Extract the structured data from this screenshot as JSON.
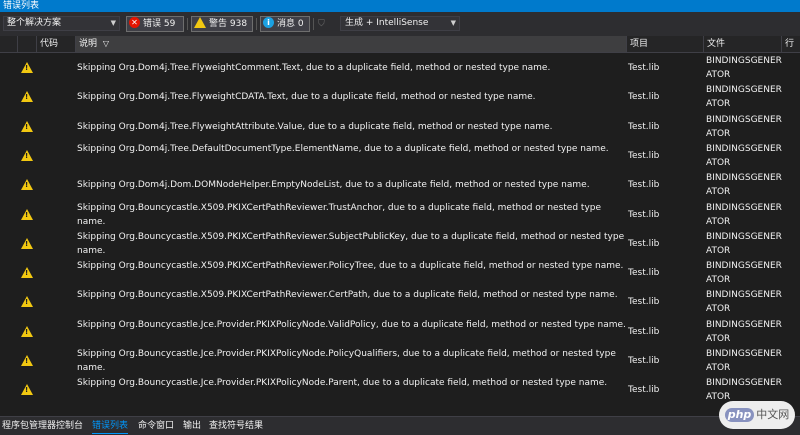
{
  "window": {
    "title": "错误列表"
  },
  "toolbar": {
    "scope": "整个解决方案",
    "errors_label": "错误 59",
    "warnings_label": "警告 938",
    "messages_label": "消息 0",
    "build_filter": "生成 + IntelliSense"
  },
  "columns": {
    "code": "代码",
    "description": "说明",
    "project": "项目",
    "file": "文件",
    "line": "行"
  },
  "rows": [
    {
      "desc": "Skipping Org.Dom4j.Tree.FlyweightComment.Text, due to a duplicate field, method or nested type name.",
      "project": "Test.lib",
      "file": "BINDINGSGENERATOR"
    },
    {
      "desc": "Skipping Org.Dom4j.Tree.FlyweightCDATA.Text, due to a duplicate field, method or nested type name.",
      "project": "Test.lib",
      "file": "BINDINGSGENERATOR"
    },
    {
      "desc": "Skipping Org.Dom4j.Tree.FlyweightAttribute.Value, due to a duplicate field, method or nested type name.",
      "project": "Test.lib",
      "file": "BINDINGSGENERATOR"
    },
    {
      "desc": "Skipping Org.Dom4j.Tree.DefaultDocumentType.ElementName, due to a duplicate field, method or nested type name.",
      "project": "Test.lib",
      "file": "BINDINGSGENERATOR"
    },
    {
      "desc": "Skipping Org.Dom4j.Dom.DOMNodeHelper.EmptyNodeList, due to a duplicate field, method or nested type name.",
      "project": "Test.lib",
      "file": "BINDINGSGENERATOR"
    },
    {
      "desc": "Skipping Org.Bouncycastle.X509.PKIXCertPathReviewer.TrustAnchor, due to a duplicate field, method or nested type name.",
      "project": "Test.lib",
      "file": "BINDINGSGENERATOR"
    },
    {
      "desc": "Skipping Org.Bouncycastle.X509.PKIXCertPathReviewer.SubjectPublicKey, due to a duplicate field, method or nested type name.",
      "project": "Test.lib",
      "file": "BINDINGSGENERATOR"
    },
    {
      "desc": "Skipping Org.Bouncycastle.X509.PKIXCertPathReviewer.PolicyTree, due to a duplicate field, method or nested type name.",
      "project": "Test.lib",
      "file": "BINDINGSGENERATOR"
    },
    {
      "desc": "Skipping Org.Bouncycastle.X509.PKIXCertPathReviewer.CertPath, due to a duplicate field, method or nested type name.",
      "project": "Test.lib",
      "file": "BINDINGSGENERATOR"
    },
    {
      "desc": "Skipping Org.Bouncycastle.Jce.Provider.PKIXPolicyNode.ValidPolicy, due to a duplicate field, method or nested type name.",
      "project": "Test.lib",
      "file": "BINDINGSGENERATOR"
    },
    {
      "desc": "Skipping Org.Bouncycastle.Jce.Provider.PKIXPolicyNode.PolicyQualifiers, due to a duplicate field, method or nested type name.",
      "project": "Test.lib",
      "file": "BINDINGSGENERATOR"
    },
    {
      "desc": "Skipping Org.Bouncycastle.Jce.Provider.PKIXPolicyNode.Parent, due to a duplicate field, method or nested type name.",
      "project": "Test.lib",
      "file": "BINDINGSGENERATOR"
    }
  ],
  "bottom_tabs": [
    "程序包管理器控制台",
    "错误列表",
    "命令窗口",
    "输出",
    "查找符号结果"
  ],
  "watermark": {
    "brand": "php",
    "text": "中文网"
  },
  "colors": {
    "accent": "#007acc",
    "warning": "#f2c811",
    "error": "#e51400",
    "info": "#1ba1e2",
    "active_tab": "#0097fb"
  }
}
